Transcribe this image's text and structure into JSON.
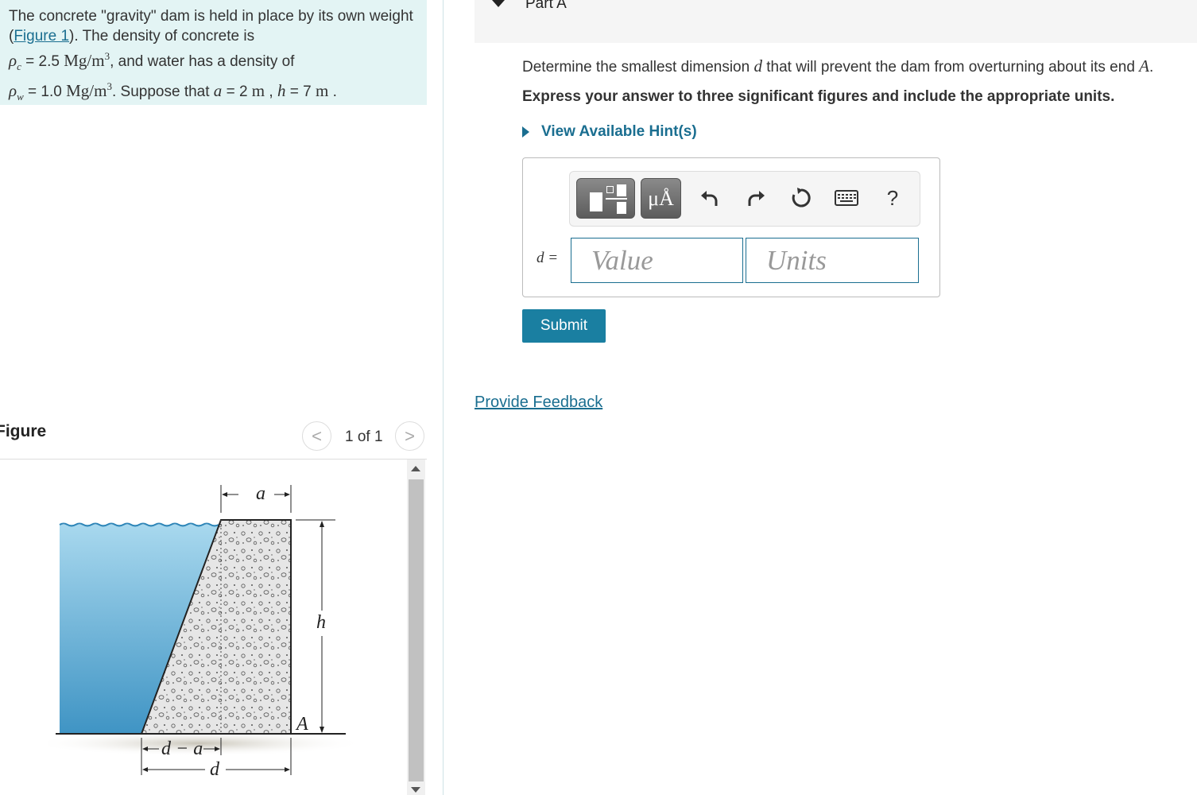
{
  "problem": {
    "intro": "The concrete \"gravity\" dam is held in place by its own weight (",
    "figure_link": "Figure 1",
    "after_link": "). The density of concrete is",
    "rho_c_symbol": "ρ",
    "rho_c_sub": "c",
    "rho_c_eq": " = 2.5 ",
    "rho_c_unit": "Mg/m",
    "rho_c_exp": "3",
    "rho_c_tail": ", and water has a density of",
    "rho_w_symbol": "ρ",
    "rho_w_sub": "w",
    "rho_w_eq": " = 1.0 ",
    "rho_w_unit": "Mg/m",
    "rho_w_exp": "3",
    "suppose": ". Suppose that ",
    "a_var": "a",
    "a_eq": " = 2 ",
    "a_unit": "m",
    "comma": " , ",
    "h_var": "h",
    "h_eq": " = 7 ",
    "h_unit": "m",
    "end": " ."
  },
  "figure": {
    "title": "Figure",
    "counter": "1 of 1",
    "prev": "<",
    "next": ">",
    "label_a": "a",
    "label_h": "h",
    "label_A": "A",
    "label_d_minus_a": "d − a",
    "label_d": "d"
  },
  "part": {
    "title": "Part A"
  },
  "question": {
    "text_before": "Determine the smallest dimension ",
    "var_d": "d",
    "text_middle": " that will prevent the dam from overturning about its end ",
    "var_A": "A",
    "text_end": ".",
    "instructions": "Express your answer to three significant figures and include the appropriate units.",
    "hint_label": "View Available Hint(s)"
  },
  "toolbar": {
    "units_label": "μÅ",
    "undo_icon": "undo-icon",
    "redo_icon": "redo-icon",
    "reset_icon": "reset-icon",
    "keyboard_icon": "keyboard-icon",
    "help_label": "?"
  },
  "answer": {
    "var_label": "d =",
    "value_placeholder": "Value",
    "units_placeholder": "Units",
    "submit_label": "Submit"
  },
  "feedback": {
    "label": "Provide Feedback"
  },
  "colors": {
    "accent": "#1a6e90",
    "problem_bg": "#e3f4f4",
    "submit_bg": "#1a7fa1",
    "water": "#5fb0d6"
  }
}
